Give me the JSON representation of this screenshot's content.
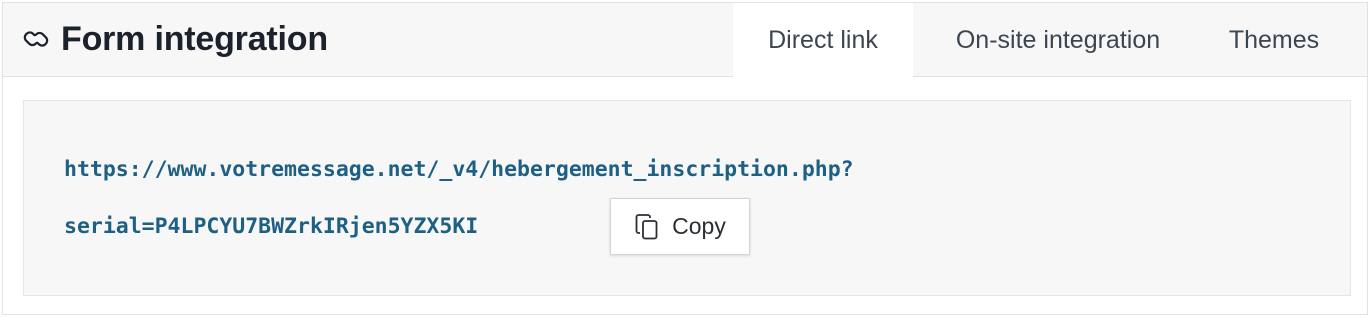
{
  "header": {
    "title": "Form integration",
    "title_icon": "link-icon"
  },
  "tabs": [
    {
      "label": "Direct link",
      "active": true
    },
    {
      "label": "On-site integration",
      "active": false
    },
    {
      "label": "Themes",
      "active": false
    }
  ],
  "direct_link": {
    "url_line_1": "https://www.votremessage.net/_v4/hebergement_inscription.php?",
    "url_line_2": "serial=P4LPCYU7BWZrkIRjen5YZX5KI",
    "copy_label": "Copy",
    "copy_icon": "copy-icon"
  },
  "colors": {
    "url_text": "#1e5f84",
    "title_text": "#1b222c",
    "header_bg": "#f7f7f7",
    "active_tab_bg": "#ffffff"
  }
}
